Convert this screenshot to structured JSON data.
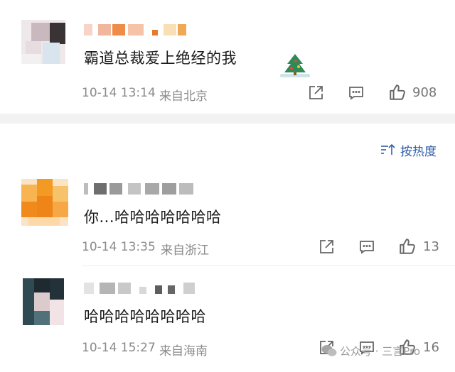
{
  "sort_label": "按热度",
  "comments": [
    {
      "text": "霸道总裁爱上绝经的我",
      "time": "10-14 13:14",
      "location": "来自北京",
      "likes": "908"
    },
    {
      "text": "你...哈哈哈哈哈哈哈",
      "time": "10-14 13:35",
      "location": "来自浙江",
      "likes": "13"
    },
    {
      "text": "哈哈哈哈哈哈哈哈",
      "time": "10-14 15:27",
      "location": "来自海南",
      "likes": "16"
    }
  ],
  "watermark": {
    "text": "公众号 · 三言Pro"
  },
  "icons": {
    "share": "share-icon",
    "comment": "comment-icon",
    "like": "thumbs-up-icon",
    "sort": "sort-icon"
  },
  "colors": {
    "link_blue": "#2f5fa8",
    "meta_gray": "#8a8a8a",
    "separator": "#f2f2f2"
  }
}
